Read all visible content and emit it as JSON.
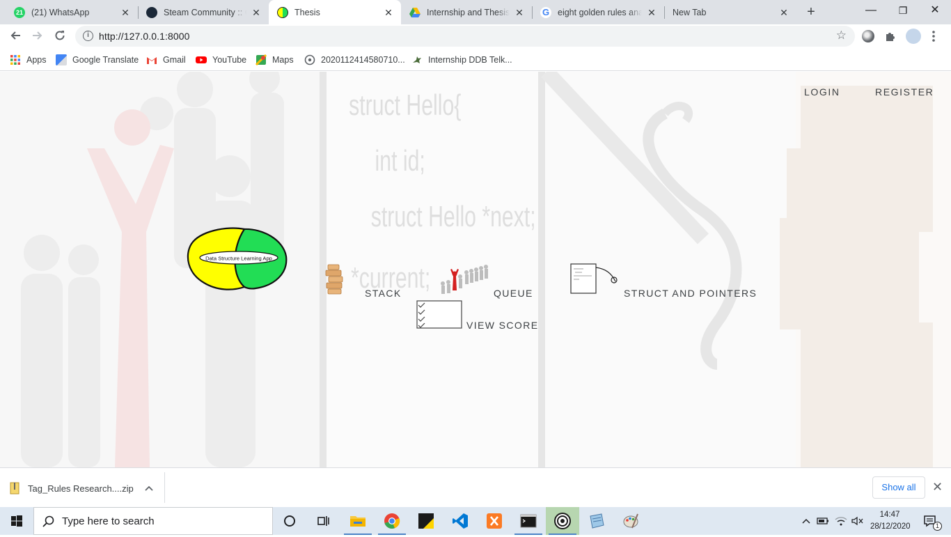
{
  "browser": {
    "tabs": [
      {
        "title": "(21) WhatsApp",
        "badge": "21",
        "color": "#25d366"
      },
      {
        "title": "Steam Community :: Gu",
        "badge": "",
        "color": "#1b2838"
      },
      {
        "title": "Thesis",
        "badge": "",
        "color": "#34a853"
      },
      {
        "title": "Internship and Thesis Bo",
        "badge": "",
        "color": "#fbbc04"
      },
      {
        "title": "eight golden rules analy",
        "badge": "G",
        "color": "#4285f4"
      },
      {
        "title": "New Tab",
        "badge": "",
        "color": ""
      }
    ],
    "new_tab_symbol": "+",
    "window_controls": {
      "minimize": "—",
      "restore": "❐",
      "close": "✕"
    },
    "url": "http://127.0.0.1:8000",
    "bookmarks": [
      {
        "label": "Apps",
        "icon": "apps-grid-icon"
      },
      {
        "label": "Google Translate",
        "icon": "translate-icon"
      },
      {
        "label": "Gmail",
        "icon": "gmail-icon"
      },
      {
        "label": "YouTube",
        "icon": "youtube-icon"
      },
      {
        "label": "Maps",
        "icon": "maps-icon"
      },
      {
        "label": "2020112414580710...",
        "icon": "globe-icon"
      },
      {
        "label": "Internship DDB Telk...",
        "icon": "bird-icon"
      }
    ]
  },
  "page": {
    "nav": {
      "login": "LOGIN",
      "register": "REGISTER"
    },
    "logo_text": "Data Structure Learning App",
    "menu": {
      "stack": "STACK",
      "queue": "QUEUE",
      "struct": "STRUCT AND POINTERS",
      "score": "VIEW SCORE"
    },
    "background_code": [
      "struct Hello{",
      "int id;",
      "struct Hello *next;",
      "*current;"
    ]
  },
  "download_bar": {
    "file_name": "Tag_Rules Research....zip",
    "show_all": "Show all"
  },
  "taskbar": {
    "search_placeholder": "Type here to search",
    "time": "14:47",
    "date": "28/12/2020",
    "notification_count": "1"
  },
  "colors": {
    "tab_strip": "#dee1e6",
    "logo_yellow": "#ffff00",
    "logo_green": "#22dd55",
    "link_blue": "#1a73e8"
  }
}
